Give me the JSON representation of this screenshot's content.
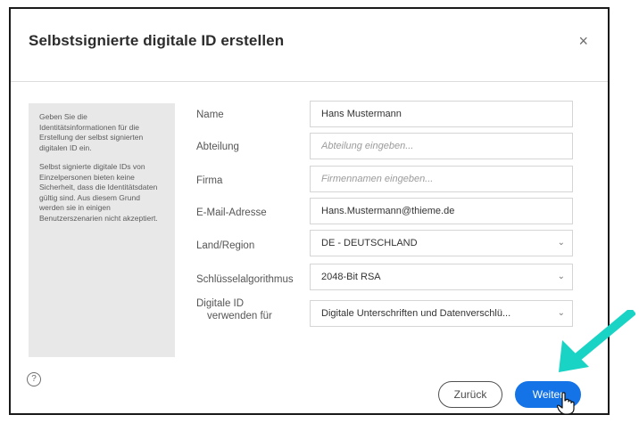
{
  "dialog": {
    "title": "Selbstsignierte digitale ID erstellen",
    "close_glyph": "×"
  },
  "info": {
    "paragraph1": "Geben Sie die Identitätsinformationen für die Erstellung der selbst signierten digitalen ID ein.",
    "paragraph2": "Selbst signierte digitale IDs von Einzelpersonen bieten keine Sicherheit, dass die Identitätsdaten gültig sind. Aus diesem Grund werden sie in einigen Benutzerszenarien nicht akzeptiert."
  },
  "form": {
    "name": {
      "label": "Name",
      "value": "Hans Mustermann",
      "placeholder": ""
    },
    "abteilung": {
      "label": "Abteilung",
      "value": "",
      "placeholder": "Abteilung eingeben..."
    },
    "firma": {
      "label": "Firma",
      "value": "",
      "placeholder": "Firmennamen eingeben..."
    },
    "email": {
      "label": "E-Mail-Adresse",
      "value": "Hans.Mustermann@thieme.de",
      "placeholder": ""
    },
    "land": {
      "label": "Land/Region",
      "value": "DE - DEUTSCHLAND"
    },
    "algorithmus": {
      "label": "Schlüsselalgorithmus",
      "value": "2048-Bit RSA"
    },
    "verwendung": {
      "label_line1": "Digitale ID",
      "label_line2": "verwenden für",
      "value": "Digitale Unterschriften und Datenverschlü..."
    }
  },
  "footer": {
    "help_glyph": "?",
    "back_label": "Zurück",
    "next_label": "Weiter"
  },
  "icons": {
    "chevron": "chevron-down-icon",
    "help": "help-icon",
    "arrow": "annotation-arrow-icon",
    "cursor": "hand-cursor-icon"
  },
  "colors": {
    "accent": "#1473e6",
    "annotation_arrow": "#19d3c5",
    "info_panel": "#e8e8e8"
  }
}
